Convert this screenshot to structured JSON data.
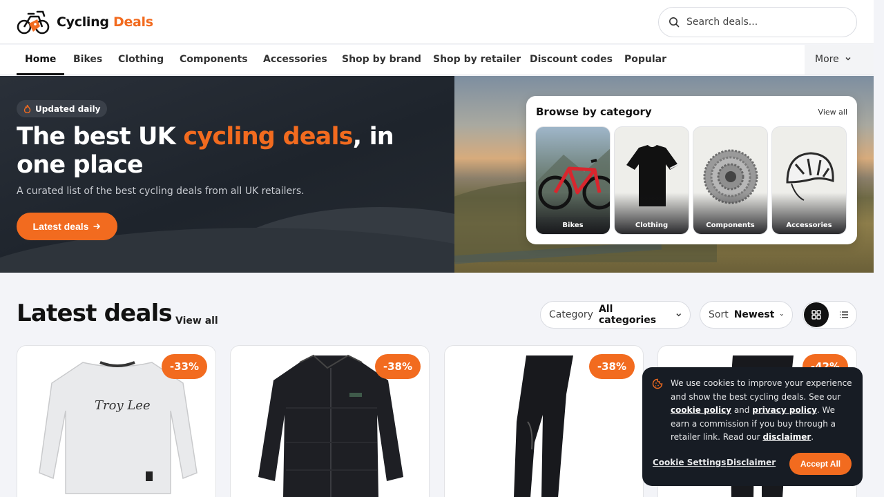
{
  "brand": {
    "name_part1": "Cycling ",
    "name_part2": "Deals"
  },
  "search": {
    "placeholder": "Search deals..."
  },
  "nav": {
    "items": [
      "Home",
      "Bikes",
      "Clothing",
      "Components",
      "Accessories",
      "Shop by brand",
      "Shop by retailer",
      "Discount codes",
      "Popular"
    ],
    "active": "Home",
    "more_label": "More"
  },
  "hero": {
    "badge": "Updated daily",
    "title_part1": "The best UK ",
    "title_accent": "cycling deals",
    "title_part2": ", in one place",
    "subtitle": "A curated list of the best cycling deals from all UK retailers.",
    "cta_label": "Latest deals"
  },
  "browse": {
    "title": "Browse by category",
    "view_all": "View all",
    "categories": [
      "Bikes",
      "Clothing",
      "Components",
      "Accessories"
    ]
  },
  "latest": {
    "title": "Latest deals",
    "view_all": "View all",
    "category_filter": {
      "label": "Category",
      "value": "All categories"
    },
    "sort_filter": {
      "label": "Sort",
      "value": "Newest"
    },
    "view_mode": "grid"
  },
  "deals": [
    {
      "discount": "-33%",
      "image": "white-long-sleeve-jersey"
    },
    {
      "discount": "-38%",
      "image": "black-flannel-shirt"
    },
    {
      "discount": "-38%",
      "image": "black-riding-pants"
    },
    {
      "discount": "-42%",
      "image": "black-riding-pants"
    }
  ],
  "cookie": {
    "text_1": "We use cookies to improve your experience and show the best cycling deals. See our ",
    "cookie_policy": "cookie policy",
    "text_2": " and ",
    "privacy_policy": "privacy policy",
    "text_3": ". We earn a commission if you buy through a retailer link. Read our ",
    "disclaimer_link": "disclaimer",
    "text_4": ".",
    "settings_label": "Cookie Settings",
    "disclaimer_label": "Disclaimer",
    "accept_label": "Accept All"
  },
  "colors": {
    "accent": "#f26b1f",
    "dark": "#171c24",
    "hero_dark": "#232931"
  }
}
